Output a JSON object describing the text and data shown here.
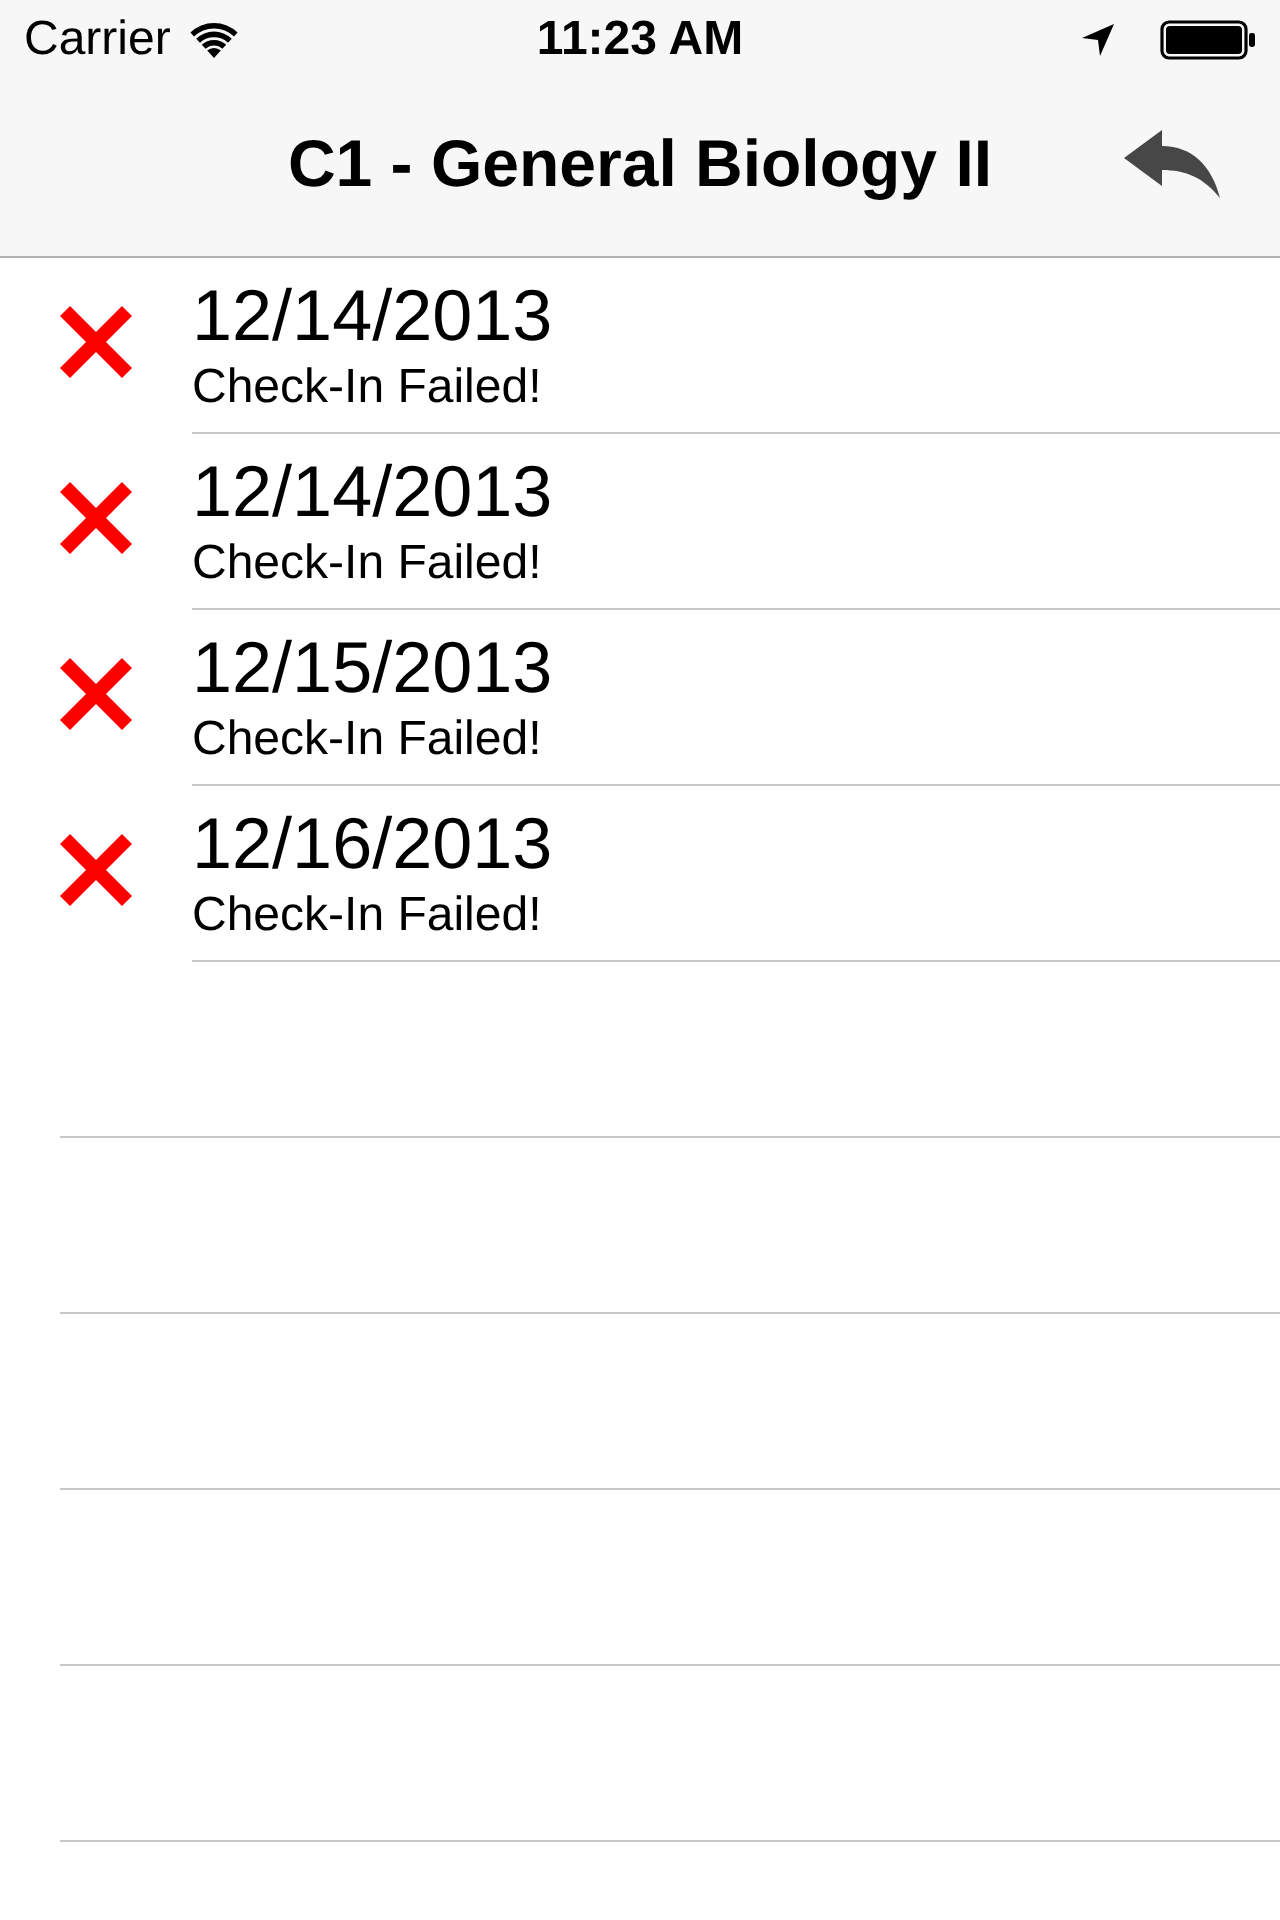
{
  "status_bar": {
    "carrier": "Carrier",
    "time": "11:23 AM"
  },
  "nav_bar": {
    "title": "C1 - General Biology II"
  },
  "checkins": [
    {
      "date": "12/14/2013",
      "status": "Check-In Failed!",
      "failed": true
    },
    {
      "date": "12/14/2013",
      "status": "Check-In Failed!",
      "failed": true
    },
    {
      "date": "12/15/2013",
      "status": "Check-In Failed!",
      "failed": true
    },
    {
      "date": "12/16/2013",
      "status": "Check-In Failed!",
      "failed": true
    }
  ]
}
